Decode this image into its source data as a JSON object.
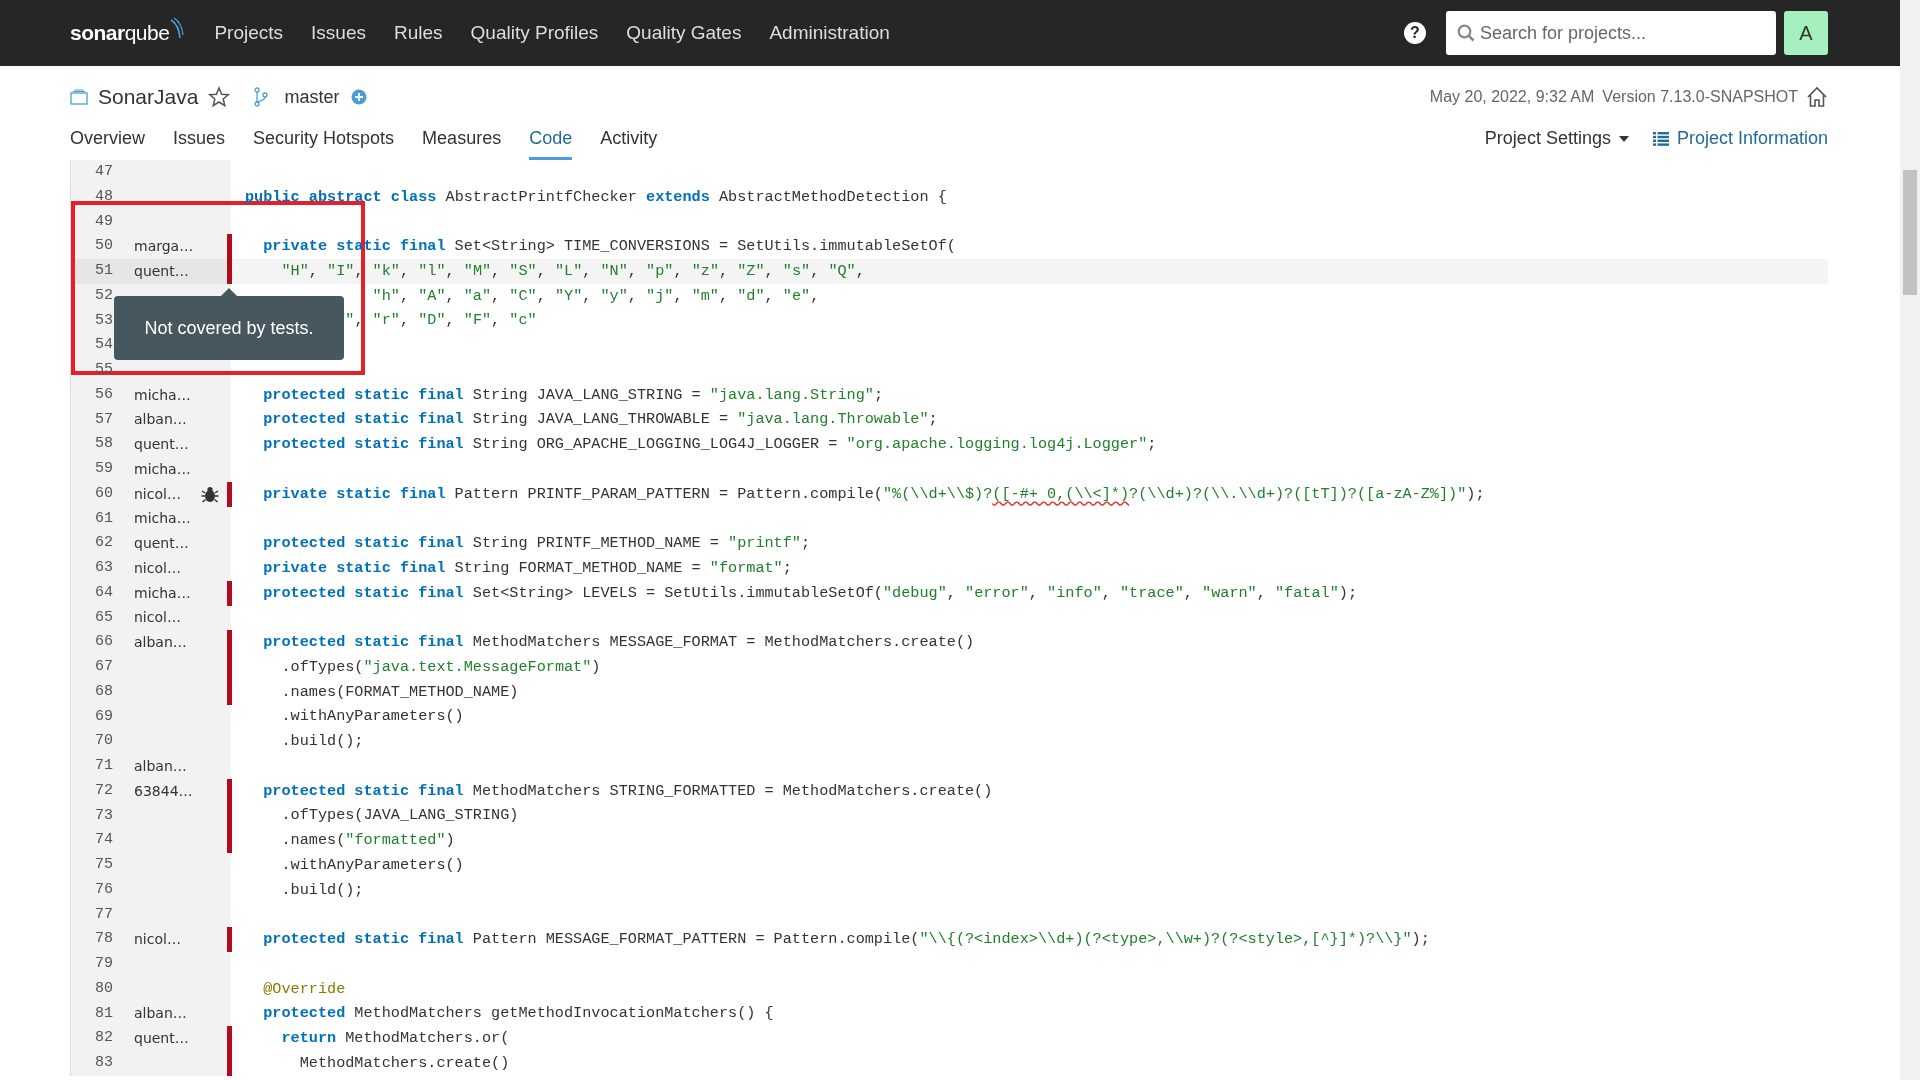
{
  "navbar": {
    "logo": "**sonar**qube",
    "items": [
      {
        "label": "Projects"
      },
      {
        "label": "Issues"
      },
      {
        "label": "Rules"
      },
      {
        "label": "Quality Profiles"
      },
      {
        "label": "Quality Gates"
      },
      {
        "label": "Administration"
      }
    ],
    "help": "?",
    "search": {
      "placeholder": "Search for projects..."
    },
    "avatar": "A"
  },
  "project": {
    "name": "SonarJava",
    "starred": false,
    "branch": "master",
    "date": "May 20, 2022, 9:32 AM",
    "version": "Version 7.13.0-SNAPSHOT"
  },
  "tabs": [
    {
      "label": "Overview",
      "selected": false
    },
    {
      "label": "Issues",
      "selected": false
    },
    {
      "label": "Security Hotspots",
      "selected": false
    },
    {
      "label": "Measures",
      "selected": false
    },
    {
      "label": "Code",
      "selected": true
    },
    {
      "label": "Activity",
      "selected": false
    }
  ],
  "actions": {
    "settings": "Project Settings",
    "information": "Project Information"
  },
  "lines": [
    {
      "n": "47",
      "uncovered": false,
      "bug": false,
      "highlighted": false
    },
    {
      "n": "48",
      "uncovered": false,
      "bug": false,
      "highlighted": false,
      "code": [
        {
          "kind": "kw",
          "text": "public abstract class"
        },
        {
          "kind": "txt",
          "text": " AbstractPrintfChecker "
        },
        {
          "kind": "kw",
          "text": "extends"
        },
        {
          "kind": "txt",
          "text": " AbstractMethodDetection {"
        }
      ]
    },
    {
      "n": "49",
      "uncovered": false,
      "bug": false,
      "highlighted": false
    },
    {
      "n": "50",
      "author": "marga…",
      "uncovered": true,
      "bug": false,
      "highlighted": false,
      "code": [
        {
          "kind": "kw",
          "text": "  private static final"
        },
        {
          "kind": "txt",
          "text": " Set<String> TIME_CONVERSIONS = SetUtils.immutableSetOf("
        }
      ]
    },
    {
      "n": "51",
      "author": "quent…",
      "uncovered": true,
      "bug": false,
      "highlighted": true,
      "code": [
        {
          "kind": "str",
          "text": "    \"H\""
        },
        {
          "kind": "txt",
          "text": ", "
        },
        {
          "kind": "str",
          "text": "\"I\""
        },
        {
          "kind": "txt",
          "text": ", "
        },
        {
          "kind": "str",
          "text": "\"k\""
        },
        {
          "kind": "txt",
          "text": ", "
        },
        {
          "kind": "str",
          "text": "\"l\""
        },
        {
          "kind": "txt",
          "text": ", "
        },
        {
          "kind": "str",
          "text": "\"M\""
        },
        {
          "kind": "txt",
          "text": ", "
        },
        {
          "kind": "str",
          "text": "\"S\""
        },
        {
          "kind": "txt",
          "text": ", "
        },
        {
          "kind": "str",
          "text": "\"L\""
        },
        {
          "kind": "txt",
          "text": ", "
        },
        {
          "kind": "str",
          "text": "\"N\""
        },
        {
          "kind": "txt",
          "text": ", "
        },
        {
          "kind": "str",
          "text": "\"p\""
        },
        {
          "kind": "txt",
          "text": ", "
        },
        {
          "kind": "str",
          "text": "\"z\""
        },
        {
          "kind": "txt",
          "text": ", "
        },
        {
          "kind": "str",
          "text": "\"Z\""
        },
        {
          "kind": "txt",
          "text": ", "
        },
        {
          "kind": "str",
          "text": "\"s\""
        },
        {
          "kind": "txt",
          "text": ", "
        },
        {
          "kind": "str",
          "text": "\"Q\""
        },
        {
          "kind": "txt",
          "text": ","
        }
      ]
    },
    {
      "n": "52",
      "uncovered": false,
      "bug": false,
      "highlighted": false,
      "code": [
        {
          "kind": "str",
          "text": "              \"h\""
        },
        {
          "kind": "txt",
          "text": ", "
        },
        {
          "kind": "str",
          "text": "\"A\""
        },
        {
          "kind": "txt",
          "text": ", "
        },
        {
          "kind": "str",
          "text": "\"a\""
        },
        {
          "kind": "txt",
          "text": ", "
        },
        {
          "kind": "str",
          "text": "\"C\""
        },
        {
          "kind": "txt",
          "text": ", "
        },
        {
          "kind": "str",
          "text": "\"Y\""
        },
        {
          "kind": "txt",
          "text": ", "
        },
        {
          "kind": "str",
          "text": "\"y\""
        },
        {
          "kind": "txt",
          "text": ", "
        },
        {
          "kind": "str",
          "text": "\"j\""
        },
        {
          "kind": "txt",
          "text": ", "
        },
        {
          "kind": "str",
          "text": "\"m\""
        },
        {
          "kind": "txt",
          "text": ", "
        },
        {
          "kind": "str",
          "text": "\"d\""
        },
        {
          "kind": "txt",
          "text": ", "
        },
        {
          "kind": "str",
          "text": "\"e\""
        },
        {
          "kind": "txt",
          "text": ","
        }
      ]
    },
    {
      "n": "53",
      "uncovered": false,
      "bug": false,
      "highlighted": false,
      "code": [
        {
          "kind": "str",
          "text": "           \""
        },
        {
          "kind": "txt",
          "text": ", "
        },
        {
          "kind": "str",
          "text": "\"r\""
        },
        {
          "kind": "txt",
          "text": ", "
        },
        {
          "kind": "str",
          "text": "\"D\""
        },
        {
          "kind": "txt",
          "text": ", "
        },
        {
          "kind": "str",
          "text": "\"F\""
        },
        {
          "kind": "txt",
          "text": ", "
        },
        {
          "kind": "str",
          "text": "\"c\""
        }
      ]
    },
    {
      "n": "54",
      "uncovered": false,
      "bug": false,
      "highlighted": false
    },
    {
      "n": "55",
      "uncovered": false,
      "bug": false,
      "highlighted": false
    },
    {
      "n": "56",
      "author": "micha…",
      "uncovered": false,
      "bug": false,
      "highlighted": false,
      "code": [
        {
          "kind": "kw",
          "text": "  protected static final"
        },
        {
          "kind": "txt",
          "text": " String JAVA_LANG_STRING = "
        },
        {
          "kind": "str",
          "text": "\"java.lang.String\""
        },
        {
          "kind": "txt",
          "text": ";"
        }
      ]
    },
    {
      "n": "57",
      "author": "alban…",
      "uncovered": false,
      "bug": false,
      "highlighted": false,
      "code": [
        {
          "kind": "kw",
          "text": "  protected static final"
        },
        {
          "kind": "txt",
          "text": " String JAVA_LANG_THROWABLE = "
        },
        {
          "kind": "str",
          "text": "\"java.lang.Throwable\""
        },
        {
          "kind": "txt",
          "text": ";"
        }
      ]
    },
    {
      "n": "58",
      "author": "quent…",
      "uncovered": false,
      "bug": false,
      "highlighted": false,
      "code": [
        {
          "kind": "kw",
          "text": "  protected static final"
        },
        {
          "kind": "txt",
          "text": " String ORG_APACHE_LOGGING_LOG4J_LOGGER = "
        },
        {
          "kind": "str",
          "text": "\"org.apache.logging.log4j.Logger\""
        },
        {
          "kind": "txt",
          "text": ";"
        }
      ]
    },
    {
      "n": "59",
      "author": "micha…",
      "uncovered": false,
      "bug": false,
      "highlighted": false
    },
    {
      "n": "60",
      "author": "nicol…",
      "uncovered": true,
      "bug": true,
      "highlighted": false,
      "code": [
        {
          "kind": "kw",
          "text": "  private static final"
        },
        {
          "kind": "txt",
          "text": " Pattern PRINTF_PARAM_PATTERN = Pattern.compile("
        },
        {
          "kind": "str",
          "text": "\"%(\\\\d+\\\\$)?"
        },
        {
          "kind": "warn",
          "text": "([-#+ 0,(\\\\<]*)"
        },
        {
          "kind": "str",
          "text": "?(\\\\d+)?(\\\\.\\\\d+)?([tT])?([a-zA-Z%])\""
        },
        {
          "kind": "txt",
          "text": ");"
        }
      ]
    },
    {
      "n": "61",
      "author": "micha…",
      "uncovered": false,
      "bug": false,
      "highlighted": false
    },
    {
      "n": "62",
      "author": "quent…",
      "uncovered": false,
      "bug": false,
      "highlighted": false,
      "code": [
        {
          "kind": "kw",
          "text": "  protected static final"
        },
        {
          "kind": "txt",
          "text": " String PRINTF_METHOD_NAME = "
        },
        {
          "kind": "str",
          "text": "\"printf\""
        },
        {
          "kind": "txt",
          "text": ";"
        }
      ]
    },
    {
      "n": "63",
      "author": "nicol…",
      "uncovered": false,
      "bug": false,
      "highlighted": false,
      "code": [
        {
          "kind": "kw",
          "text": "  private static final"
        },
        {
          "kind": "txt",
          "text": " String FORMAT_METHOD_NAME = "
        },
        {
          "kind": "str",
          "text": "\"format\""
        },
        {
          "kind": "txt",
          "text": ";"
        }
      ]
    },
    {
      "n": "64",
      "author": "micha…",
      "uncovered": true,
      "bug": false,
      "highlighted": false,
      "code": [
        {
          "kind": "kw",
          "text": "  protected static final"
        },
        {
          "kind": "txt",
          "text": " Set<String> LEVELS = SetUtils.immutableSetOf("
        },
        {
          "kind": "str",
          "text": "\"debug\""
        },
        {
          "kind": "txt",
          "text": ", "
        },
        {
          "kind": "str",
          "text": "\"error\""
        },
        {
          "kind": "txt",
          "text": ", "
        },
        {
          "kind": "str",
          "text": "\"info\""
        },
        {
          "kind": "txt",
          "text": ", "
        },
        {
          "kind": "str",
          "text": "\"trace\""
        },
        {
          "kind": "txt",
          "text": ", "
        },
        {
          "kind": "str",
          "text": "\"warn\""
        },
        {
          "kind": "txt",
          "text": ", "
        },
        {
          "kind": "str",
          "text": "\"fatal\""
        },
        {
          "kind": "txt",
          "text": ");"
        }
      ]
    },
    {
      "n": "65",
      "author": "nicol…",
      "uncovered": false,
      "bug": false,
      "highlighted": false
    },
    {
      "n": "66",
      "author": "alban…",
      "uncovered": true,
      "bug": false,
      "highlighted": false,
      "code": [
        {
          "kind": "kw",
          "text": "  protected static final"
        },
        {
          "kind": "txt",
          "text": " MethodMatchers MESSAGE_FORMAT = MethodMatchers.create()"
        }
      ]
    },
    {
      "n": "67",
      "uncovered": true,
      "bug": false,
      "highlighted": false,
      "code": [
        {
          "kind": "txt",
          "text": "    .ofTypes("
        },
        {
          "kind": "str",
          "text": "\"java.text.MessageFormat\""
        },
        {
          "kind": "txt",
          "text": ")"
        }
      ]
    },
    {
      "n": "68",
      "uncovered": true,
      "bug": false,
      "highlighted": false,
      "code": [
        {
          "kind": "txt",
          "text": "    .names(FORMAT_METHOD_NAME)"
        }
      ]
    },
    {
      "n": "69",
      "uncovered": false,
      "bug": false,
      "highlighted": false,
      "code": [
        {
          "kind": "txt",
          "text": "    .withAnyParameters()"
        }
      ]
    },
    {
      "n": "70",
      "uncovered": false,
      "bug": false,
      "highlighted": false,
      "code": [
        {
          "kind": "txt",
          "text": "    .build();"
        }
      ]
    },
    {
      "n": "71",
      "author": "alban…",
      "uncovered": false,
      "bug": false,
      "highlighted": false
    },
    {
      "n": "72",
      "author": "63844…",
      "uncovered": true,
      "bug": false,
      "highlighted": false,
      "code": [
        {
          "kind": "kw",
          "text": "  protected static final"
        },
        {
          "kind": "txt",
          "text": " MethodMatchers STRING_FORMATTED = MethodMatchers.create()"
        }
      ]
    },
    {
      "n": "73",
      "uncovered": true,
      "bug": false,
      "highlighted": false,
      "code": [
        {
          "kind": "txt",
          "text": "    .ofTypes(JAVA_LANG_STRING)"
        }
      ]
    },
    {
      "n": "74",
      "uncovered": true,
      "bug": false,
      "highlighted": false,
      "code": [
        {
          "kind": "txt",
          "text": "    .names("
        },
        {
          "kind": "str",
          "text": "\"formatted\""
        },
        {
          "kind": "txt",
          "text": ")"
        }
      ]
    },
    {
      "n": "75",
      "uncovered": false,
      "bug": false,
      "highlighted": false,
      "code": [
        {
          "kind": "txt",
          "text": "    .withAnyParameters()"
        }
      ]
    },
    {
      "n": "76",
      "uncovered": false,
      "bug": false,
      "highlighted": false,
      "code": [
        {
          "kind": "txt",
          "text": "    .build();"
        }
      ]
    },
    {
      "n": "77",
      "uncovered": false,
      "bug": false,
      "highlighted": false
    },
    {
      "n": "78",
      "author": "nicol…",
      "uncovered": true,
      "bug": false,
      "highlighted": false,
      "code": [
        {
          "kind": "kw",
          "text": "  protected static final"
        },
        {
          "kind": "txt",
          "text": " Pattern MESSAGE_FORMAT_PATTERN = Pattern.compile("
        },
        {
          "kind": "str",
          "text": "\"\\\\{(?<index>\\\\d+)(?<type>,\\\\w+)?(?<style>,[^}]*)?\\\\}\""
        },
        {
          "kind": "txt",
          "text": ");"
        }
      ]
    },
    {
      "n": "79",
      "uncovered": false,
      "bug": false,
      "highlighted": false
    },
    {
      "n": "80",
      "uncovered": false,
      "bug": false,
      "highlighted": false,
      "code": [
        {
          "kind": "ann",
          "text": "  @Override"
        }
      ]
    },
    {
      "n": "81",
      "author": "alban…",
      "uncovered": false,
      "bug": false,
      "highlighted": false,
      "code": [
        {
          "kind": "kw",
          "text": "  protected"
        },
        {
          "kind": "txt",
          "text": " MethodMatchers getMethodInvocationMatchers() {"
        }
      ]
    },
    {
      "n": "82",
      "author": "quent…",
      "uncovered": true,
      "bug": false,
      "highlighted": false,
      "code": [
        {
          "kind": "kw",
          "text": "    return"
        },
        {
          "kind": "txt",
          "text": " MethodMatchers.or("
        }
      ]
    },
    {
      "n": "83",
      "uncovered": true,
      "bug": false,
      "highlighted": false,
      "code": [
        {
          "kind": "txt",
          "text": "      MethodMatchers.create()"
        }
      ]
    }
  ],
  "tooltip": {
    "text": "Not covered by tests."
  },
  "annotation": {
    "kind": "frame"
  }
}
